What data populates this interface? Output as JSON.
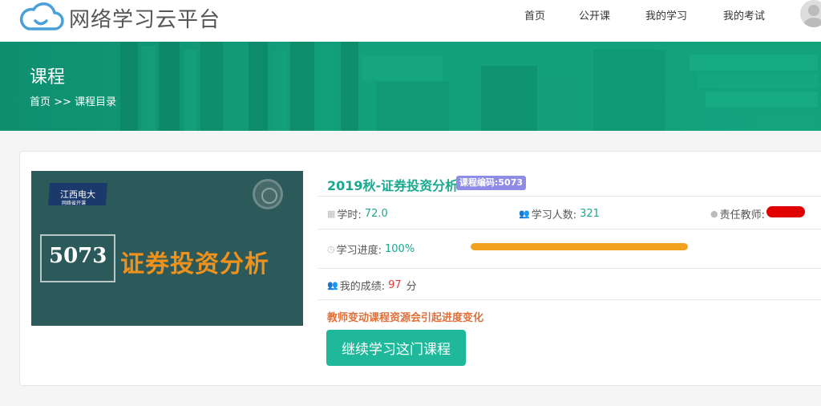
{
  "header": {
    "logo_text": "网络学习云平台",
    "nav": [
      "首页",
      "公开课",
      "我的学习",
      "我的考试"
    ]
  },
  "banner": {
    "title": "课程",
    "breadcrumb_home": "首页",
    "breadcrumb_sep": ">>",
    "breadcrumb_current": "课程目录"
  },
  "cover": {
    "tag_line1": "江西电大",
    "tag_line2": "网络省开课",
    "code": "5073",
    "name": "证券投资分析"
  },
  "course": {
    "title": "2019秋-证券投资分析",
    "code_badge": "课程编码:5073",
    "hours_label": "学时:",
    "hours_value": "72.0",
    "students_label": "学习人数:",
    "students_value": "321",
    "teacher_label": "责任教师:",
    "progress_label": "学习进度:",
    "progress_value": "100%",
    "progress_fraction": 1.0,
    "score_label": "我的成绩:",
    "score_value": "97",
    "score_unit": "分",
    "notice": "教师变动课程资源会引起进度变化",
    "continue_button": "继续学习这门课程"
  },
  "colors": {
    "accent": "#1aa88e",
    "button": "#1fb89a",
    "progress": "#f0a11e",
    "badge": "#8e8ce6",
    "notice": "#e0703a",
    "score": "#e03b3b"
  },
  "icons": [
    "cloud-logo-icon",
    "clock-icon",
    "users-icon",
    "user-icon",
    "progress-clock-icon",
    "score-users-icon",
    "avatar-icon"
  ]
}
